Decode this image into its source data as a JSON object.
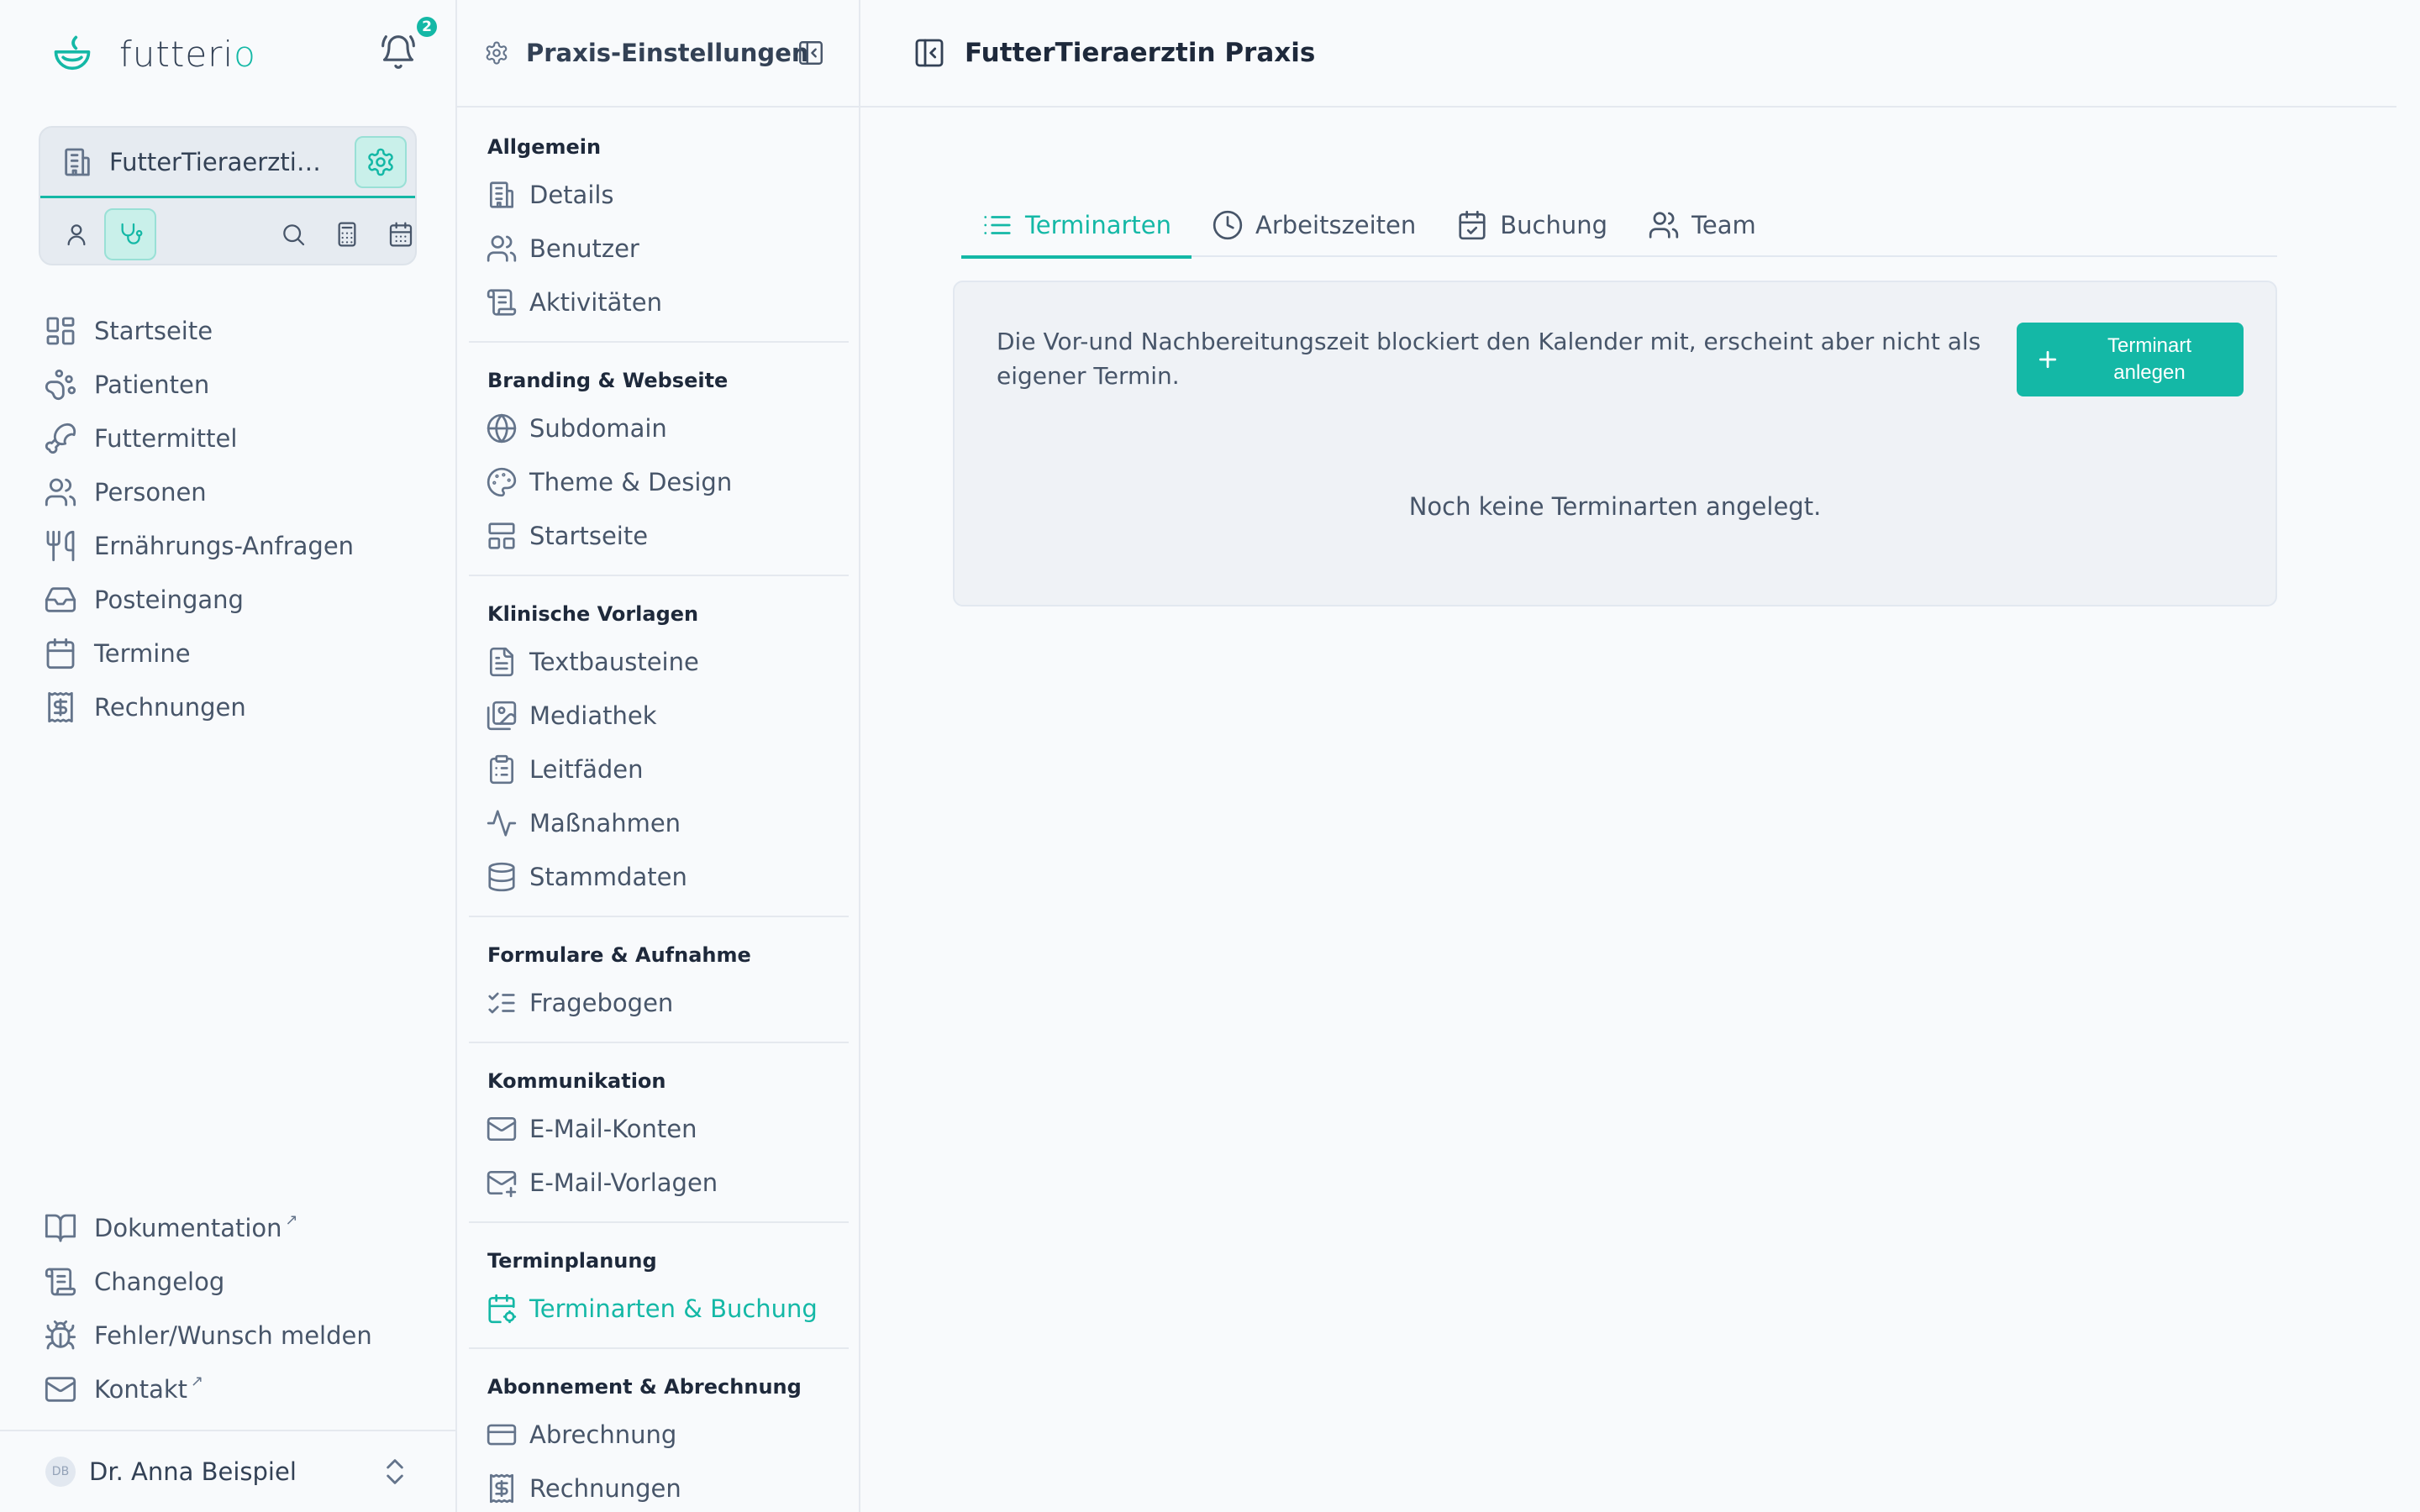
{
  "brand": {
    "name_main": "futteri",
    "name_accent": "o",
    "notification_count": "2"
  },
  "practice": {
    "name": "FutterTieraerztin P..."
  },
  "nav": {
    "items": [
      {
        "label": "Startseite",
        "icon": "grid-icon"
      },
      {
        "label": "Patienten",
        "icon": "paw-icon"
      },
      {
        "label": "Futtermittel",
        "icon": "food-icon"
      },
      {
        "label": "Personen",
        "icon": "users-icon"
      },
      {
        "label": "Ernährungs-Anfragen",
        "icon": "utensils-icon"
      },
      {
        "label": "Posteingang",
        "icon": "inbox-icon"
      },
      {
        "label": "Termine",
        "icon": "calendar-icon"
      },
      {
        "label": "Rechnungen",
        "icon": "receipt-icon"
      }
    ],
    "bottom": [
      {
        "label": "Dokumentation",
        "icon": "book-icon",
        "external": "↗"
      },
      {
        "label": "Changelog",
        "icon": "scroll-icon"
      },
      {
        "label": "Fehler/Wunsch melden",
        "icon": "bug-icon"
      },
      {
        "label": "Kontakt",
        "icon": "mail-icon",
        "external": "↗"
      }
    ]
  },
  "user": {
    "initials": "DB",
    "name": "Dr. Anna Beispiel"
  },
  "settings": {
    "title": "Praxis-Einstellungen",
    "groups": [
      {
        "title": "Allgemein",
        "items": [
          "Details",
          "Benutzer",
          "Aktivitäten"
        ]
      },
      {
        "title": "Branding & Webseite",
        "items": [
          "Subdomain",
          "Theme & Design",
          "Startseite"
        ]
      },
      {
        "title": "Klinische Vorlagen",
        "items": [
          "Textbausteine",
          "Mediathek",
          "Leitfäden",
          "Maßnahmen",
          "Stammdaten"
        ]
      },
      {
        "title": "Formulare & Aufnahme",
        "items": [
          "Fragebogen"
        ]
      },
      {
        "title": "Kommunikation",
        "items": [
          "E-Mail-Konten",
          "E-Mail-Vorlagen"
        ]
      },
      {
        "title": "Terminplanung",
        "items": [
          "Terminarten & Buchung"
        ]
      },
      {
        "title": "Abonnement & Abrechnung",
        "items": [
          "Abrechnung",
          "Rechnungen"
        ]
      }
    ]
  },
  "main": {
    "title": "FutterTieraerztin Praxis",
    "tabs": [
      {
        "label": "Terminarten",
        "active": true
      },
      {
        "label": "Arbeitszeiten"
      },
      {
        "label": "Buchung"
      },
      {
        "label": "Team"
      }
    ],
    "info": "Die Vor-und Nachbereitungszeit blockiert den Kalender mit, erscheint aber nicht als eigener Termin.",
    "create_line1": "Terminart",
    "create_line2": "anlegen",
    "empty": "Noch keine Terminarten angelegt."
  },
  "colors": {
    "accent": "#14b8a6",
    "text": "#475569",
    "heading": "#1e293b"
  }
}
